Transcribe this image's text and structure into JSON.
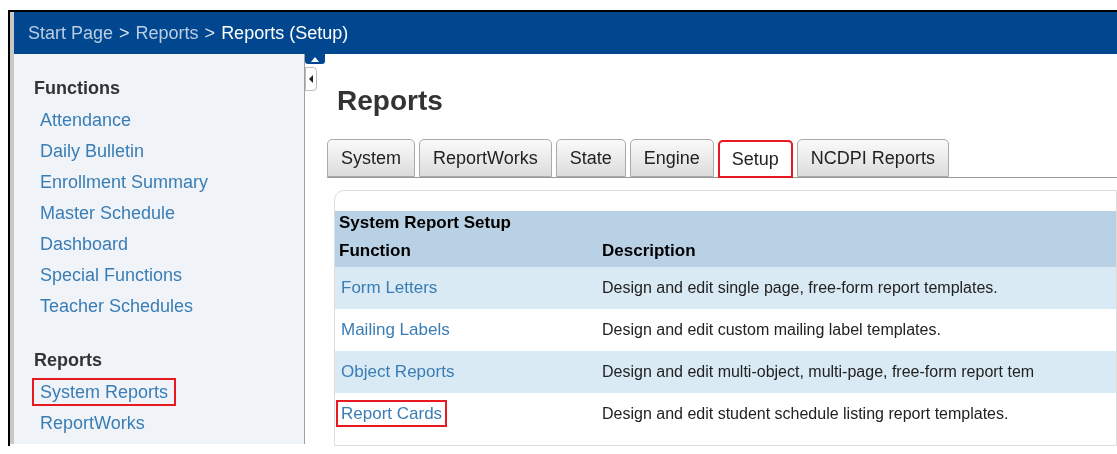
{
  "breadcrumb": {
    "items": [
      {
        "label": "Start Page",
        "current": false
      },
      {
        "label": "Reports",
        "current": false
      },
      {
        "label": "Reports (Setup)",
        "current": true
      }
    ],
    "separators": [
      ">",
      ">"
    ]
  },
  "sidebar": {
    "sections": [
      {
        "heading": "Functions",
        "items": [
          {
            "label": "Attendance",
            "highlighted": false
          },
          {
            "label": "Daily Bulletin",
            "highlighted": false
          },
          {
            "label": "Enrollment Summary",
            "highlighted": false
          },
          {
            "label": "Master Schedule",
            "highlighted": false
          },
          {
            "label": "Dashboard",
            "highlighted": false
          },
          {
            "label": "Special Functions",
            "highlighted": false
          },
          {
            "label": "Teacher Schedules",
            "highlighted": false
          }
        ]
      },
      {
        "heading": "Reports",
        "items": [
          {
            "label": "System Reports",
            "highlighted": true
          },
          {
            "label": "ReportWorks",
            "highlighted": false
          }
        ]
      }
    ]
  },
  "title": "Reports",
  "tabs": [
    {
      "label": "System",
      "selected": false,
      "highlighted": false
    },
    {
      "label": "ReportWorks",
      "selected": false,
      "highlighted": false
    },
    {
      "label": "State",
      "selected": false,
      "highlighted": false
    },
    {
      "label": "Engine",
      "selected": false,
      "highlighted": false
    },
    {
      "label": "Setup",
      "selected": true,
      "highlighted": true
    },
    {
      "label": "NCDPI Reports",
      "selected": false,
      "highlighted": false
    }
  ],
  "table": {
    "caption": "System Report Setup",
    "columns": [
      "Function",
      "Description"
    ],
    "rows": [
      {
        "function": "Form Letters",
        "description": "Design and edit single page, free-form report templates.",
        "highlighted": false
      },
      {
        "function": "Mailing Labels",
        "description": "Design and edit custom mailing label templates.",
        "highlighted": false
      },
      {
        "function": "Object Reports",
        "description": "Design and edit multi-object, multi-page, free-form report tem",
        "highlighted": false
      },
      {
        "function": "Report Cards",
        "description": "Design and edit student schedule listing report templates.",
        "highlighted": true
      }
    ]
  }
}
